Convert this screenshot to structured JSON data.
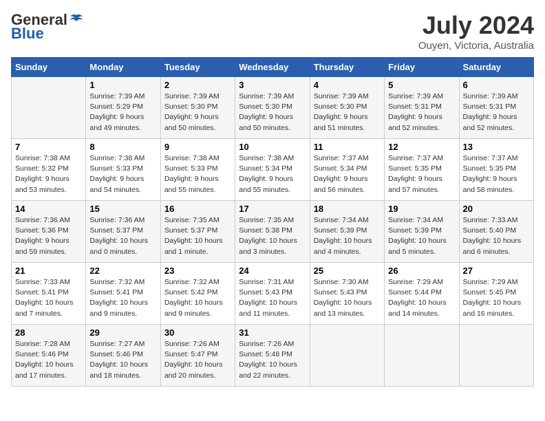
{
  "logo": {
    "general": "General",
    "blue": "Blue"
  },
  "header": {
    "month": "July 2024",
    "location": "Ouyen, Victoria, Australia"
  },
  "columns": [
    "Sunday",
    "Monday",
    "Tuesday",
    "Wednesday",
    "Thursday",
    "Friday",
    "Saturday"
  ],
  "weeks": [
    [
      {
        "day": "",
        "info": ""
      },
      {
        "day": "1",
        "info": "Sunrise: 7:39 AM\nSunset: 5:29 PM\nDaylight: 9 hours\nand 49 minutes."
      },
      {
        "day": "2",
        "info": "Sunrise: 7:39 AM\nSunset: 5:30 PM\nDaylight: 9 hours\nand 50 minutes."
      },
      {
        "day": "3",
        "info": "Sunrise: 7:39 AM\nSunset: 5:30 PM\nDaylight: 9 hours\nand 50 minutes."
      },
      {
        "day": "4",
        "info": "Sunrise: 7:39 AM\nSunset: 5:30 PM\nDaylight: 9 hours\nand 51 minutes."
      },
      {
        "day": "5",
        "info": "Sunrise: 7:39 AM\nSunset: 5:31 PM\nDaylight: 9 hours\nand 52 minutes."
      },
      {
        "day": "6",
        "info": "Sunrise: 7:39 AM\nSunset: 5:31 PM\nDaylight: 9 hours\nand 52 minutes."
      }
    ],
    [
      {
        "day": "7",
        "info": "Sunrise: 7:38 AM\nSunset: 5:32 PM\nDaylight: 9 hours\nand 53 minutes."
      },
      {
        "day": "8",
        "info": "Sunrise: 7:38 AM\nSunset: 5:33 PM\nDaylight: 9 hours\nand 54 minutes."
      },
      {
        "day": "9",
        "info": "Sunrise: 7:38 AM\nSunset: 5:33 PM\nDaylight: 9 hours\nand 55 minutes."
      },
      {
        "day": "10",
        "info": "Sunrise: 7:38 AM\nSunset: 5:34 PM\nDaylight: 9 hours\nand 55 minutes."
      },
      {
        "day": "11",
        "info": "Sunrise: 7:37 AM\nSunset: 5:34 PM\nDaylight: 9 hours\nand 56 minutes."
      },
      {
        "day": "12",
        "info": "Sunrise: 7:37 AM\nSunset: 5:35 PM\nDaylight: 9 hours\nand 57 minutes."
      },
      {
        "day": "13",
        "info": "Sunrise: 7:37 AM\nSunset: 5:35 PM\nDaylight: 9 hours\nand 58 minutes."
      }
    ],
    [
      {
        "day": "14",
        "info": "Sunrise: 7:36 AM\nSunset: 5:36 PM\nDaylight: 9 hours\nand 59 minutes."
      },
      {
        "day": "15",
        "info": "Sunrise: 7:36 AM\nSunset: 5:37 PM\nDaylight: 10 hours\nand 0 minutes."
      },
      {
        "day": "16",
        "info": "Sunrise: 7:35 AM\nSunset: 5:37 PM\nDaylight: 10 hours\nand 1 minute."
      },
      {
        "day": "17",
        "info": "Sunrise: 7:35 AM\nSunset: 5:38 PM\nDaylight: 10 hours\nand 3 minutes."
      },
      {
        "day": "18",
        "info": "Sunrise: 7:34 AM\nSunset: 5:39 PM\nDaylight: 10 hours\nand 4 minutes."
      },
      {
        "day": "19",
        "info": "Sunrise: 7:34 AM\nSunset: 5:39 PM\nDaylight: 10 hours\nand 5 minutes."
      },
      {
        "day": "20",
        "info": "Sunrise: 7:33 AM\nSunset: 5:40 PM\nDaylight: 10 hours\nand 6 minutes."
      }
    ],
    [
      {
        "day": "21",
        "info": "Sunrise: 7:33 AM\nSunset: 5:41 PM\nDaylight: 10 hours\nand 7 minutes."
      },
      {
        "day": "22",
        "info": "Sunrise: 7:32 AM\nSunset: 5:41 PM\nDaylight: 10 hours\nand 9 minutes."
      },
      {
        "day": "23",
        "info": "Sunrise: 7:32 AM\nSunset: 5:42 PM\nDaylight: 10 hours\nand 9 minutes."
      },
      {
        "day": "24",
        "info": "Sunrise: 7:31 AM\nSunset: 5:43 PM\nDaylight: 10 hours\nand 11 minutes."
      },
      {
        "day": "25",
        "info": "Sunrise: 7:30 AM\nSunset: 5:43 PM\nDaylight: 10 hours\nand 13 minutes."
      },
      {
        "day": "26",
        "info": "Sunrise: 7:29 AM\nSunset: 5:44 PM\nDaylight: 10 hours\nand 14 minutes."
      },
      {
        "day": "27",
        "info": "Sunrise: 7:29 AM\nSunset: 5:45 PM\nDaylight: 10 hours\nand 16 minutes."
      }
    ],
    [
      {
        "day": "28",
        "info": "Sunrise: 7:28 AM\nSunset: 5:46 PM\nDaylight: 10 hours\nand 17 minutes."
      },
      {
        "day": "29",
        "info": "Sunrise: 7:27 AM\nSunset: 5:46 PM\nDaylight: 10 hours\nand 18 minutes."
      },
      {
        "day": "30",
        "info": "Sunrise: 7:26 AM\nSunset: 5:47 PM\nDaylight: 10 hours\nand 20 minutes."
      },
      {
        "day": "31",
        "info": "Sunrise: 7:26 AM\nSunset: 5:48 PM\nDaylight: 10 hours\nand 22 minutes."
      },
      {
        "day": "",
        "info": ""
      },
      {
        "day": "",
        "info": ""
      },
      {
        "day": "",
        "info": ""
      }
    ]
  ]
}
